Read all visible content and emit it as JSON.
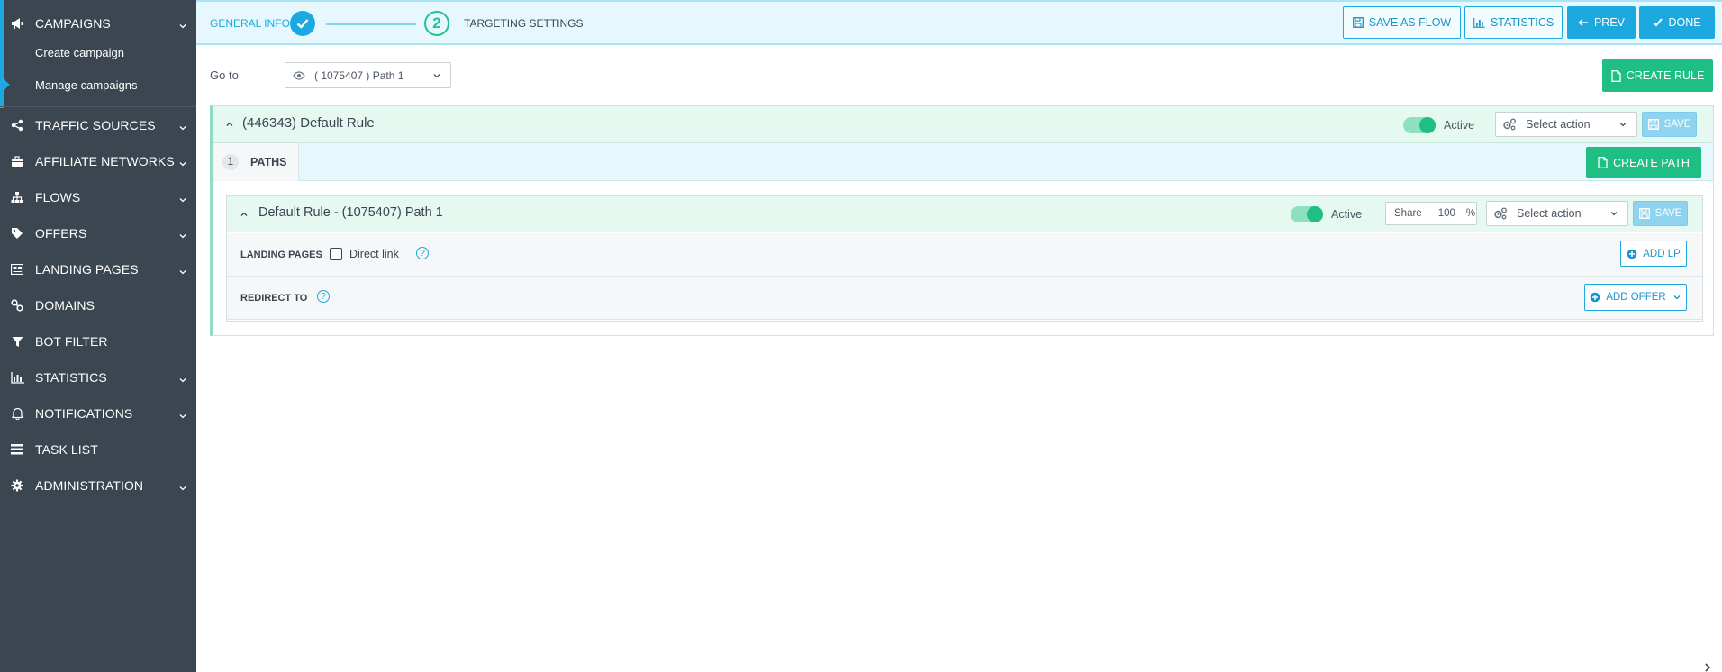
{
  "sidebar": {
    "campaigns": "CAMPAIGNS",
    "sub_items": [
      "Create campaign",
      "Manage campaigns"
    ],
    "items": [
      {
        "label": "TRAFFIC SOURCES",
        "icon": "share-icon",
        "has_children": true
      },
      {
        "label": "AFFILIATE NETWORKS",
        "icon": "briefcase-icon",
        "has_children": true
      },
      {
        "label": "FLOWS",
        "icon": "sitemap-icon",
        "has_children": true
      },
      {
        "label": "OFFERS",
        "icon": "tags-icon",
        "has_children": true
      },
      {
        "label": "LANDING PAGES",
        "icon": "page-icon",
        "has_children": true
      },
      {
        "label": "DOMAINS",
        "icon": "link-icon",
        "has_children": false
      },
      {
        "label": "BOT FILTER",
        "icon": "filter-icon",
        "has_children": false
      },
      {
        "label": "STATISTICS",
        "icon": "bar-chart-icon",
        "has_children": true
      },
      {
        "label": "NOTIFICATIONS",
        "icon": "bell-icon",
        "has_children": true
      },
      {
        "label": "TASK LIST",
        "icon": "list-icon",
        "has_children": false
      },
      {
        "label": "ADMINISTRATION",
        "icon": "gear-icon",
        "has_children": true
      }
    ]
  },
  "wizard": {
    "step1_label": "GENERAL INFO",
    "step2_number": "2",
    "step2_label": "TARGETING SETTINGS"
  },
  "toolbar": {
    "save_as_flow": "SAVE AS FLOW",
    "statistics": "STATISTICS",
    "prev": "PREV",
    "done": "DONE"
  },
  "goto": {
    "label": "Go to",
    "selected": "( 1075407 ) Path 1"
  },
  "create_rule": "CREATE RULE",
  "rule": {
    "title": "(446343) Default Rule",
    "active_label": "Active",
    "active": true,
    "action_placeholder": "Select action",
    "save": "SAVE"
  },
  "paths": {
    "count": "1",
    "tab_label": "PATHS",
    "create_path": "CREATE PATH"
  },
  "path": {
    "title": "Default Rule - (1075407) Path 1",
    "active_label": "Active",
    "active": true,
    "share_label": "Share",
    "share_value": "100",
    "share_unit": "%",
    "action_placeholder": "Select action",
    "save": "SAVE",
    "landing_pages_label": "LANDING PAGES",
    "direct_link_label": "Direct link",
    "direct_link_checked": false,
    "add_lp": "ADD LP",
    "redirect_to_label": "REDIRECT TO",
    "add_offer": "ADD OFFER"
  },
  "colors": {
    "sidebar_bg": "#3c4650",
    "accent_blue": "#1ba9e0",
    "accent_green": "#1fbf83",
    "topbar_bg": "#e6f8fd"
  }
}
